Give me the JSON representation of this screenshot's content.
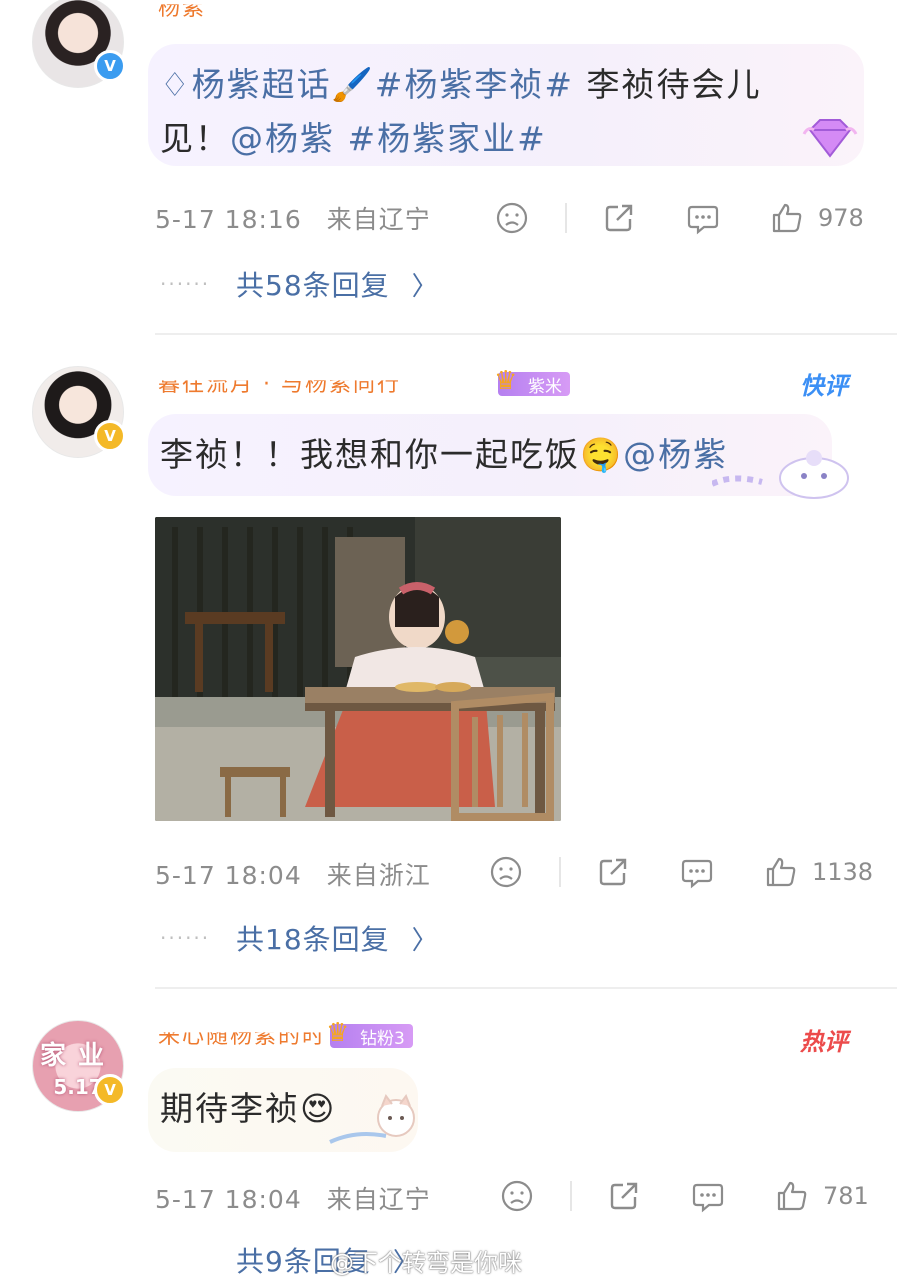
{
  "comments": [
    {
      "username": "杨紫",
      "verify_icon": "V",
      "content_prefix_icon": "diamond-icon",
      "content_parts": [
        "杨紫超话",
        "🖌️",
        "#杨紫李祯#",
        " 李祯待会儿见！",
        "@杨紫",
        " ",
        "#杨紫家业#"
      ],
      "time": "5-17 18:16",
      "location": "来自辽宁",
      "likes": "978",
      "replies": "共58条回复"
    },
    {
      "username": "暮往流月 · 与杨紫同行",
      "fan_badge": "紫米",
      "tag": "快评",
      "verify_icon": "V",
      "content_parts": [
        "李祯！！我想和你一起吃饭",
        "🤤",
        "@杨紫"
      ],
      "time": "5-17 18:04",
      "location": "来自浙江",
      "likes": "1138",
      "replies": "共18条回复"
    },
    {
      "username": "来心随杨紫的时",
      "fan_badge": "钻粉3",
      "tag": "热评",
      "verify_icon": "V",
      "avatar_text": [
        "家",
        "业",
        "5.17"
      ],
      "content_parts": [
        "期待李祯",
        "😍"
      ],
      "time": "5-17 18:04",
      "location": "来自辽宁",
      "likes": "781",
      "replies": "共9条回复"
    }
  ],
  "watermark": "@下个转弯是你咪",
  "colors": {
    "link": "#4a6fa5",
    "meta": "#8c8c8c",
    "username": "#ee7a2e",
    "quick_tag": "#3b8ff5",
    "hot_tag": "#ec4b4b"
  }
}
